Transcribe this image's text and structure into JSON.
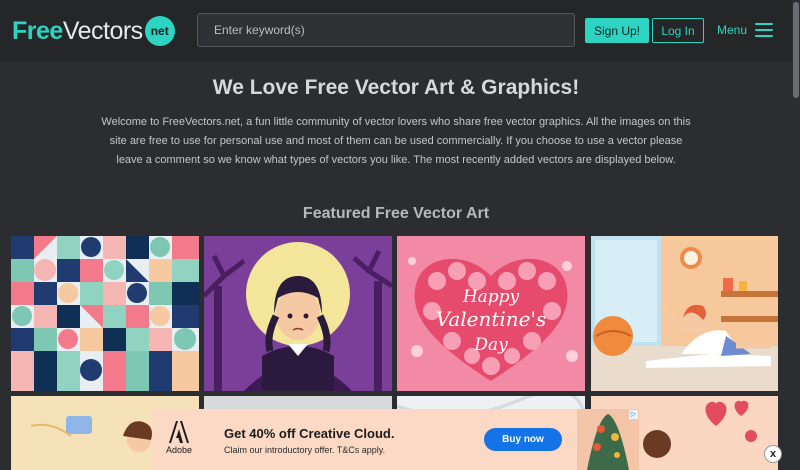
{
  "header": {
    "logo_free": "Free",
    "logo_vectors": "Vectors",
    "logo_net": "net",
    "search_placeholder": "Enter keyword(s)",
    "signup_label": "Sign Up!",
    "login_label": "Log In",
    "menu_label": "Menu"
  },
  "hero": {
    "title": "We Love Free Vector Art & Graphics!",
    "description": "Welcome to FreeVectors.net, a fun little community of vector lovers who share free vector graphics. All the images on this site are free to use for personal use and most of them can be used commercially. If you choose to use a vector please leave a comment so we know what types of vectors you like. The most recently added vectors are displayed below."
  },
  "featured": {
    "title": "Featured Free Vector Art",
    "thumbs": [
      {
        "name": "geometric-pattern",
        "text": ""
      },
      {
        "name": "girl-halloween-moon",
        "text": ""
      },
      {
        "name": "valentines-heart",
        "text": "Happy Valentine's Day"
      },
      {
        "name": "yoga-stretch",
        "text": ""
      },
      {
        "name": "student-illustration",
        "text": ""
      },
      {
        "name": "grey-placeholder",
        "text": ""
      },
      {
        "name": "marble-texture",
        "text": ""
      },
      {
        "name": "couple-hearts",
        "text": ""
      }
    ]
  },
  "ad": {
    "brand": "Adobe",
    "headline": "Get 40% off Creative Cloud.",
    "subline": "Claim our introductory offer. T&Cs apply.",
    "cta": "Buy now",
    "close": "x"
  },
  "colors": {
    "accent": "#2dd4c1",
    "background": "#2b2d30",
    "header": "#242628",
    "ad_background": "#fbd9c4",
    "ad_button": "#1473e6"
  }
}
